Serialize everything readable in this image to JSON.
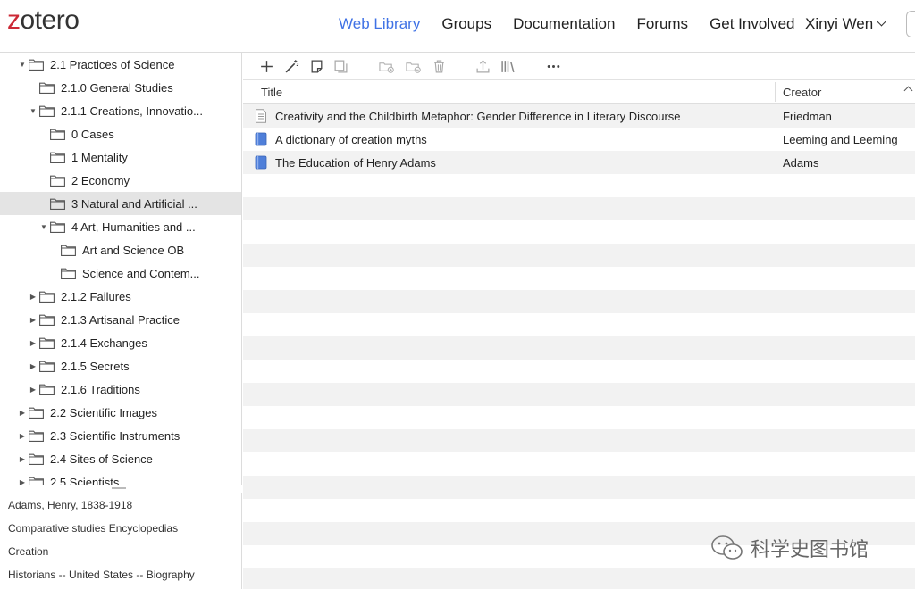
{
  "header": {
    "logo": "zotero",
    "nav": [
      "Web Library",
      "Groups",
      "Documentation",
      "Forums",
      "Get Involved"
    ],
    "user": "Xinyi Wen"
  },
  "tree": [
    {
      "label": "2.1 Practices of Science",
      "level": 1,
      "twisty": "open",
      "selected": false
    },
    {
      "label": "2.1.0 General Studies",
      "level": 2,
      "twisty": "none",
      "selected": false
    },
    {
      "label": "2.1.1 Creations, Innovatio...",
      "level": 2,
      "twisty": "open",
      "selected": false
    },
    {
      "label": "0 Cases",
      "level": 3,
      "twisty": "none",
      "selected": false
    },
    {
      "label": "1 Mentality",
      "level": 3,
      "twisty": "none",
      "selected": false
    },
    {
      "label": "2 Economy",
      "level": 3,
      "twisty": "none",
      "selected": false
    },
    {
      "label": "3 Natural and Artificial ...",
      "level": 3,
      "twisty": "none",
      "selected": true
    },
    {
      "label": "4 Art, Humanities and ...",
      "level": 3,
      "twisty": "open",
      "selected": false
    },
    {
      "label": "Art and Science OB",
      "level": 4,
      "twisty": "none",
      "selected": false
    },
    {
      "label": "Science and Contem...",
      "level": 4,
      "twisty": "none",
      "selected": false
    },
    {
      "label": "2.1.2 Failures",
      "level": 2,
      "twisty": "closed",
      "selected": false
    },
    {
      "label": "2.1.3 Artisanal Practice",
      "level": 2,
      "twisty": "closed",
      "selected": false
    },
    {
      "label": "2.1.4 Exchanges",
      "level": 2,
      "twisty": "closed",
      "selected": false
    },
    {
      "label": "2.1.5 Secrets",
      "level": 2,
      "twisty": "closed",
      "selected": false
    },
    {
      "label": "2.1.6 Traditions",
      "level": 2,
      "twisty": "closed",
      "selected": false
    },
    {
      "label": "2.2 Scientific Images",
      "level": 1,
      "twisty": "closed",
      "selected": false
    },
    {
      "label": "2.3 Scientific Instruments",
      "level": 1,
      "twisty": "closed",
      "selected": false
    },
    {
      "label": "2.4 Sites of Science",
      "level": 1,
      "twisty": "closed",
      "selected": false
    },
    {
      "label": "2.5 Scientists",
      "level": 1,
      "twisty": "closed",
      "selected": false
    }
  ],
  "tags": [
    "Adams, Henry, 1838-1918",
    "Comparative studies Encyclopedias",
    "Creation",
    "Historians -- United States -- Biography"
  ],
  "toolbar_icons": [
    "new-item-icon",
    "magic-wand-icon",
    "new-note-icon",
    "duplicate-icon",
    "add-to-collection-icon",
    "remove-from-collection-icon",
    "trash-icon",
    "export-icon",
    "library-icon",
    "more-icon"
  ],
  "columns": {
    "title": "Title",
    "creator": "Creator"
  },
  "items": [
    {
      "title": "Creativity and the Childbirth Metaphor: Gender Difference in Literary Discourse",
      "creator": "Friedman",
      "type": "document"
    },
    {
      "title": "A dictionary of creation myths",
      "creator": "Leeming and Leeming",
      "type": "book"
    },
    {
      "title": "The Education of Henry Adams",
      "creator": "Adams",
      "type": "book"
    }
  ],
  "watermark": "科学史图书馆",
  "colors": {
    "accent": "#4072e5",
    "logo_z": "#cc2936",
    "selected_row": "#e4e4e4",
    "alt_row": "#f2f2f2"
  }
}
